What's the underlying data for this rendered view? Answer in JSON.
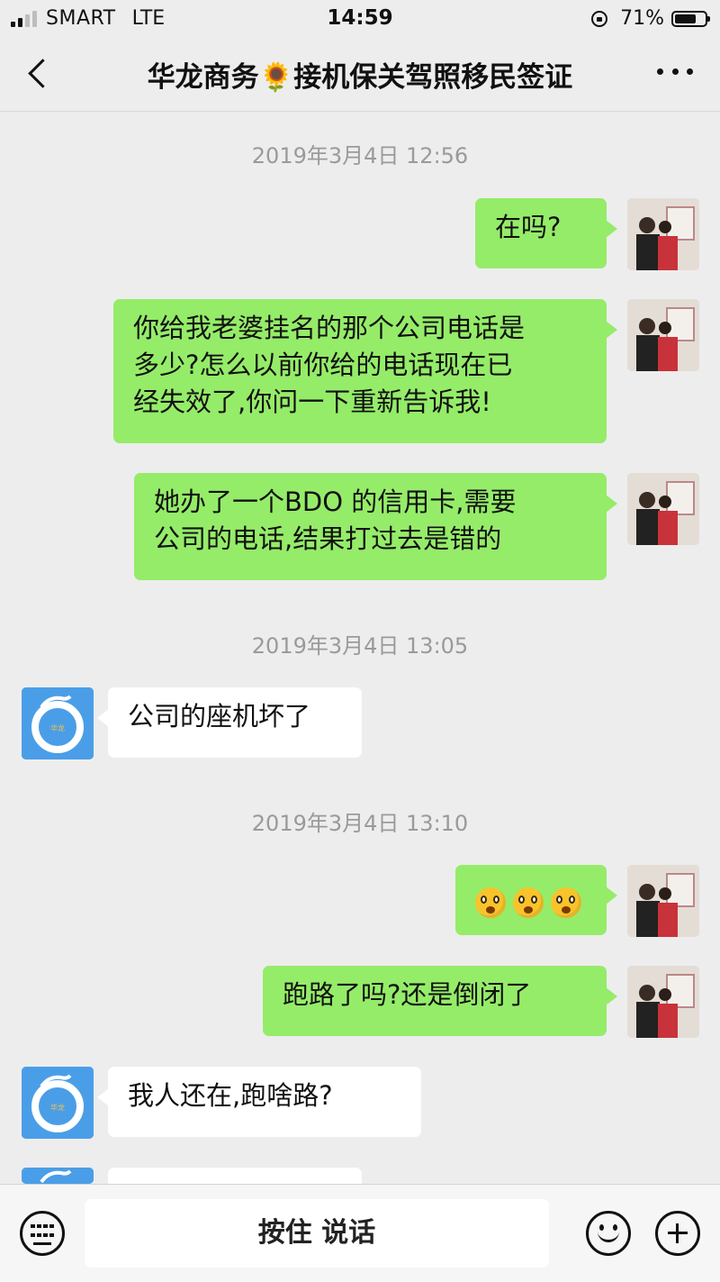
{
  "status_bar": {
    "carrier": "SMART",
    "network": "LTE",
    "time": "14:59",
    "battery": "71%",
    "battery_level": 0.71
  },
  "nav": {
    "title": "华龙商务🌻接机保关驾照移民签证"
  },
  "timestamps": [
    "2019年3月4日 12:56",
    "2019年3月4日 13:05",
    "2019年3月4日 13:10"
  ],
  "messages": [
    {
      "sender": "me",
      "text": "在吗?"
    },
    {
      "sender": "me",
      "lines": [
        "你给我老婆挂名的那个公司电话是",
        "多少?怎么以前你给的电话现在已",
        "经失效了,你问一下重新告诉我!"
      ]
    },
    {
      "sender": "me",
      "lines": [
        "她办了一个BDO 的信用卡,需要",
        "公司的电话,结果打过去是错的"
      ]
    },
    {
      "sender": "them",
      "text": "公司的座机坏了"
    },
    {
      "sender": "me",
      "emoji": [
        "surprised-face",
        "surprised-face",
        "surprised-face"
      ]
    },
    {
      "sender": "me",
      "text": "跑路了吗?还是倒闭了"
    },
    {
      "sender": "them",
      "text": "我人还在,跑啥路?"
    }
  ],
  "input_bar": {
    "talk_label": "按住 说话"
  },
  "colors": {
    "background": "#ededed",
    "my_bubble": "#95ec69",
    "their_bubble": "#ffffff",
    "their_avatar": "#4a9ee7"
  }
}
